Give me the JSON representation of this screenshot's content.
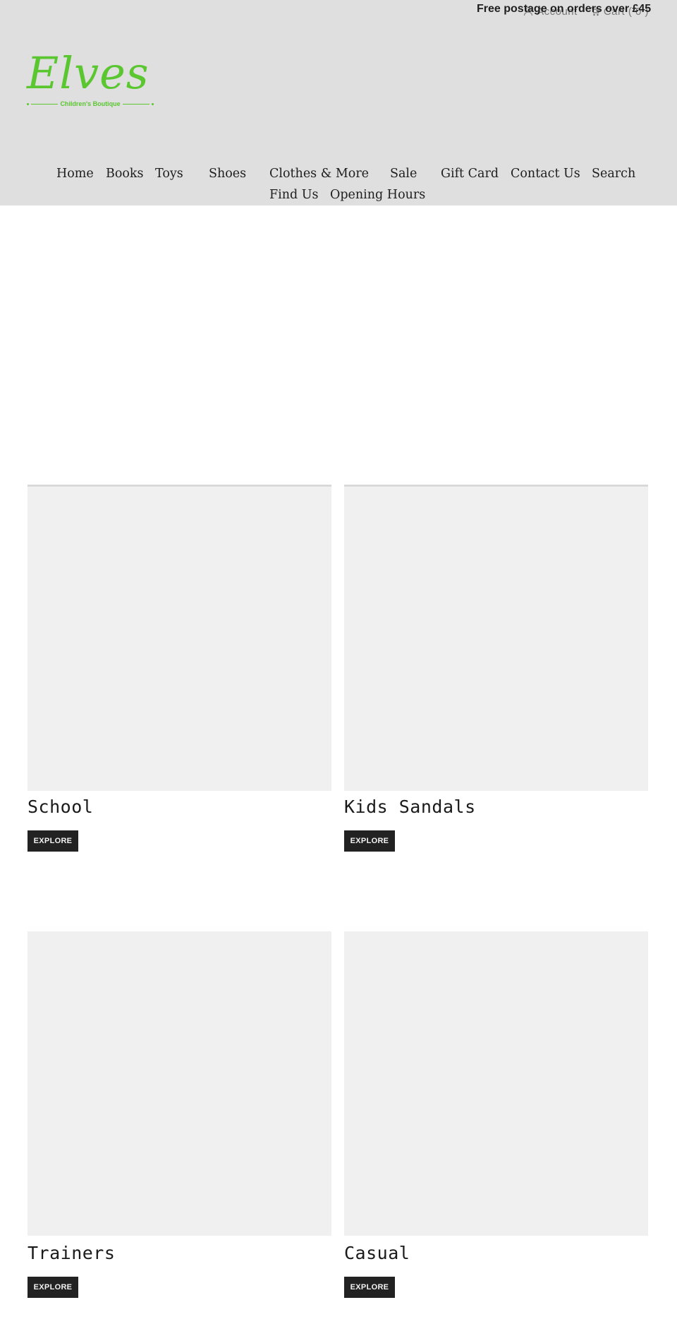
{
  "header": {
    "promo_text": "Free postage on orders over £45",
    "account_label": "Account",
    "cart_label": "Cart ( 0 )",
    "logo": {
      "wordmark": "Elves",
      "tagline": "Children's Boutique",
      "color": "#5ac630"
    },
    "background_color": "#dfdfdf"
  },
  "nav": {
    "items": [
      {
        "label": "Home"
      },
      {
        "label": "Books"
      },
      {
        "label": "Toys"
      },
      {
        "label": "Shoes"
      },
      {
        "label": "Clothes & More"
      },
      {
        "label": "Sale"
      },
      {
        "label": "Gift Card"
      },
      {
        "label": "Contact Us"
      },
      {
        "label": "Search"
      },
      {
        "label": "Find Us"
      },
      {
        "label": "Opening Hours"
      }
    ]
  },
  "collections": [
    {
      "title": "School",
      "button_label": "EXPLORE"
    },
    {
      "title": "Kids Sandals",
      "button_label": "EXPLORE"
    },
    {
      "title": "Trainers",
      "button_label": "EXPLORE"
    },
    {
      "title": "Casual",
      "button_label": "EXPLORE"
    }
  ]
}
